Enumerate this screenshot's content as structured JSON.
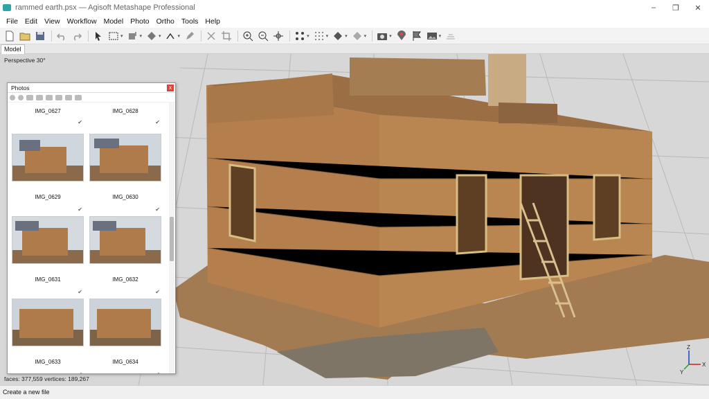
{
  "window": {
    "title": "rammed earth.psx — Agisoft Metashape Professional",
    "controls": [
      "–",
      "❐",
      "✕"
    ]
  },
  "menu": [
    "File",
    "Edit",
    "View",
    "Workflow",
    "Model",
    "Photo",
    "Ortho",
    "Tools",
    "Help"
  ],
  "tabs": {
    "model": "Model"
  },
  "viewport": {
    "projection": "Perspective 30°",
    "stats": "faces: 377,559 vertices: 189,267"
  },
  "photos_panel": {
    "title": "Photos",
    "close": "x",
    "items": [
      {
        "name": "IMG_0627",
        "check": "✔"
      },
      {
        "name": "IMG_0628",
        "check": "✔"
      },
      {
        "name": "IMG_0629",
        "check": "✔"
      },
      {
        "name": "IMG_0630",
        "check": "✔"
      },
      {
        "name": "IMG_0631",
        "check": "✔"
      },
      {
        "name": "IMG_0632",
        "check": "✔"
      },
      {
        "name": "IMG_0633",
        "check": "✔"
      },
      {
        "name": "IMG_0634",
        "check": "✔"
      }
    ]
  },
  "axes": {
    "x": "X",
    "y": "Y",
    "z": "Z"
  },
  "status": "Create a new file",
  "colors": {
    "accent": "#2ea6a6",
    "close": "#d9443b",
    "viewport": "#d7d7d7",
    "earth": "#b07b4a"
  }
}
